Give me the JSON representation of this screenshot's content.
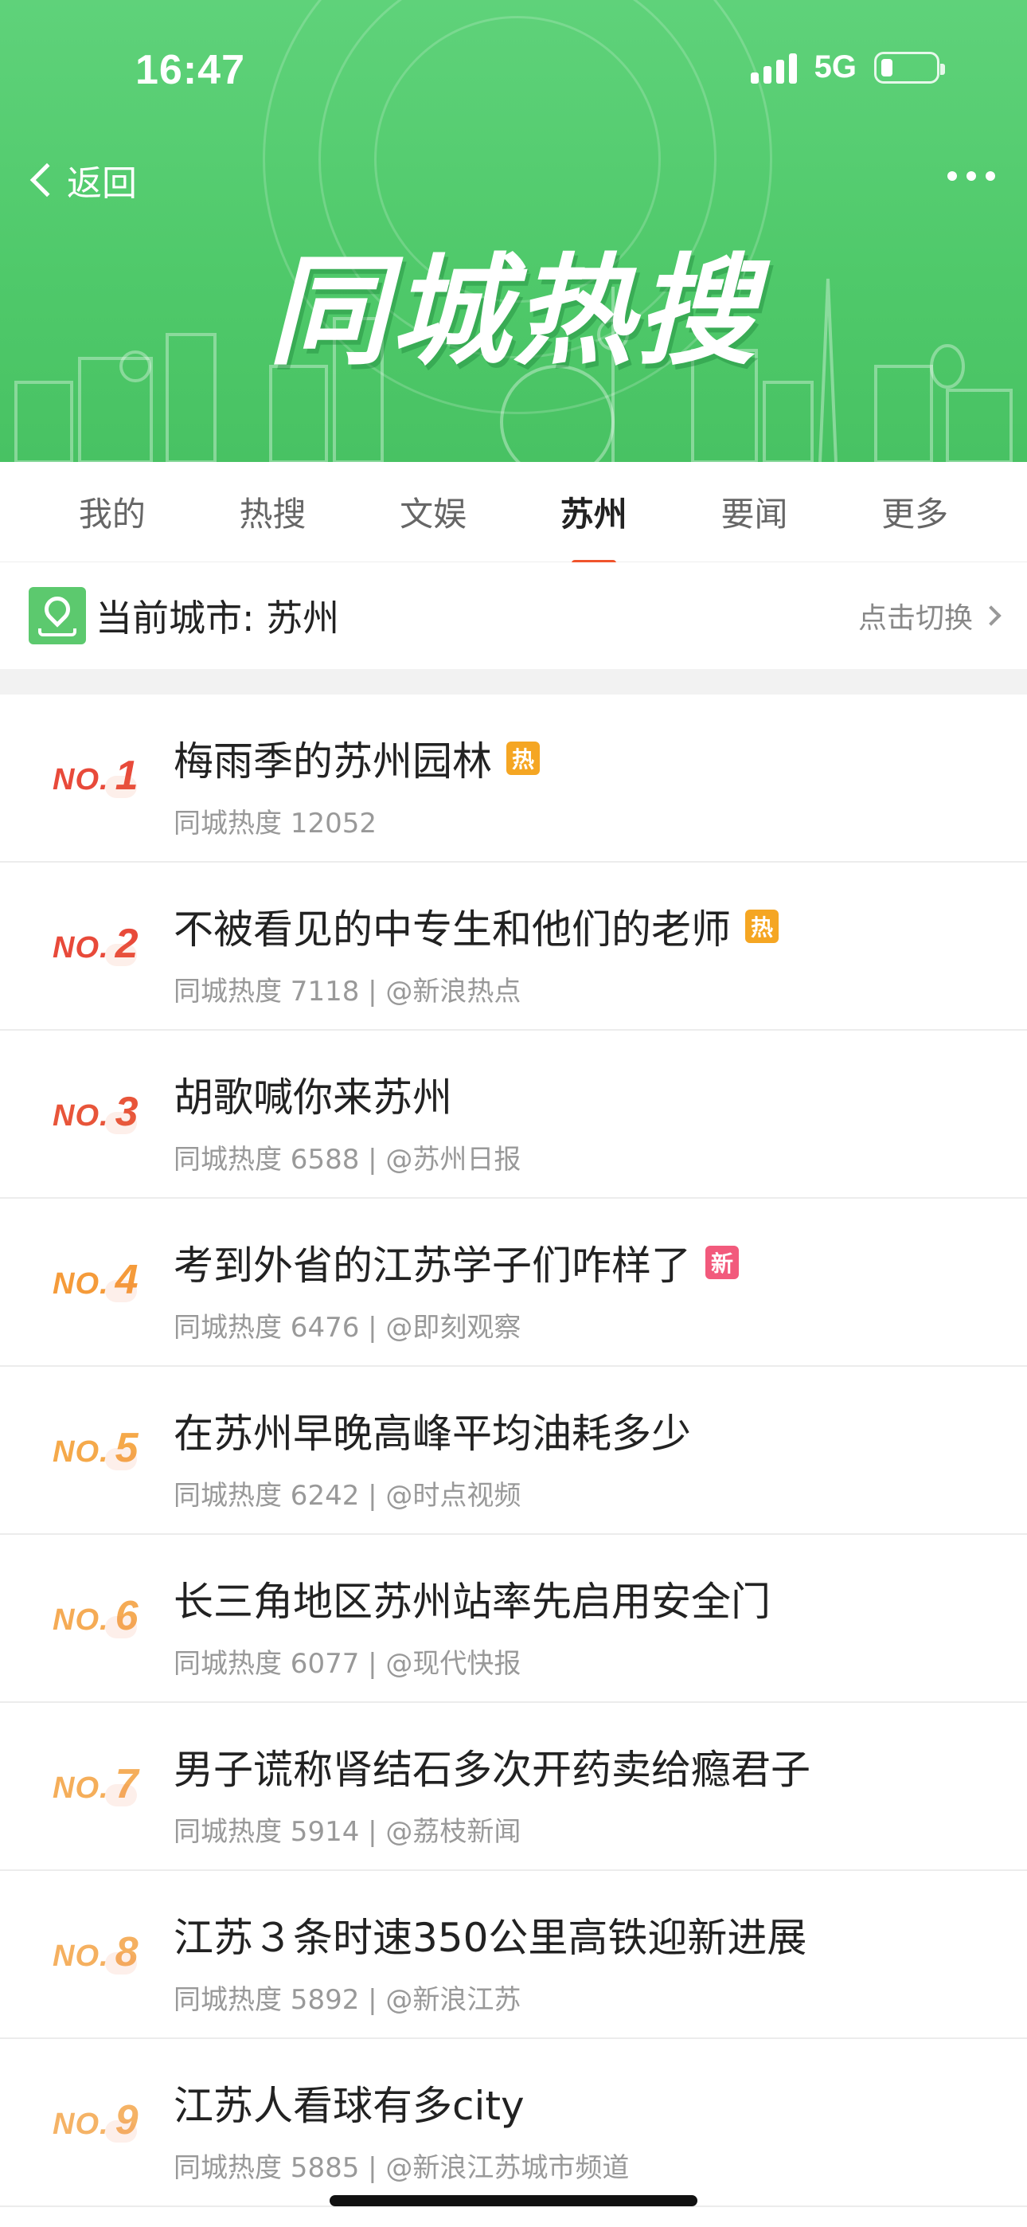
{
  "status_bar": {
    "time": "16:47",
    "network": "5G"
  },
  "nav": {
    "back_label": "返回"
  },
  "hero": {
    "title": "同城热搜"
  },
  "tabs": [
    {
      "label": "我的",
      "active": false
    },
    {
      "label": "热搜",
      "active": false
    },
    {
      "label": "文娱",
      "active": false
    },
    {
      "label": "苏州",
      "active": true
    },
    {
      "label": "要闻",
      "active": false
    },
    {
      "label": "更多",
      "active": false
    }
  ],
  "city": {
    "label": "当前城市: 苏州",
    "switch_label": "点击切换"
  },
  "colors": {
    "banner_green": "#4fc96a",
    "tab_underline": "#f0542c",
    "badge_hot": "#f5a623",
    "badge_new": "#f25a7c"
  },
  "list": [
    {
      "no": "NO.",
      "rank": "1",
      "rank_color": "#e84a3a",
      "title": "梅雨季的苏州园林",
      "badge": "热",
      "badge_color": "#f5a623",
      "meta": "同城热度 12052"
    },
    {
      "no": "NO.",
      "rank": "2",
      "rank_color": "#e84a3a",
      "title": "不被看见的中专生和他们的老师",
      "badge": "热",
      "badge_color": "#f5a623",
      "meta": "同城热度 7118 | @新浪热点"
    },
    {
      "no": "NO.",
      "rank": "3",
      "rank_color": "#e8553a",
      "title": "胡歌喊你来苏州",
      "badge": "",
      "badge_color": "",
      "meta": "同城热度 6588 | @苏州日报"
    },
    {
      "no": "NO.",
      "rank": "4",
      "rank_color": "#f59b3a",
      "title": "考到外省的江苏学子们咋样了",
      "badge": "新",
      "badge_color": "#f25a7c",
      "meta": "同城热度 6476 | @即刻观察"
    },
    {
      "no": "NO.",
      "rank": "5",
      "rank_color": "#f5a94a",
      "title": "在苏州早晚高峰平均油耗多少",
      "badge": "",
      "badge_color": "",
      "meta": "同城热度 6242 | @时点视频"
    },
    {
      "no": "NO.",
      "rank": "6",
      "rank_color": "#f5ab55",
      "title": "长三角地区苏州站率先启用安全门",
      "badge": "",
      "badge_color": "",
      "meta": "同城热度 6077 | @现代快报"
    },
    {
      "no": "NO.",
      "rank": "7",
      "rank_color": "#f5ae5a",
      "title": "男子谎称肾结石多次开药卖给瘾君子",
      "badge": "",
      "badge_color": "",
      "meta": "同城热度 5914 | @荔枝新闻"
    },
    {
      "no": "NO.",
      "rank": "8",
      "rank_color": "#f5b060",
      "title": "江苏３条时速350公里高铁迎新进展",
      "badge": "",
      "badge_color": "",
      "meta": "同城热度 5892 | @新浪江苏"
    },
    {
      "no": "NO.",
      "rank": "9",
      "rank_color": "#f5b366",
      "title": "江苏人看球有多city",
      "badge": "",
      "badge_color": "",
      "meta": "同城热度 5885 | @新浪江苏城市频道"
    }
  ]
}
